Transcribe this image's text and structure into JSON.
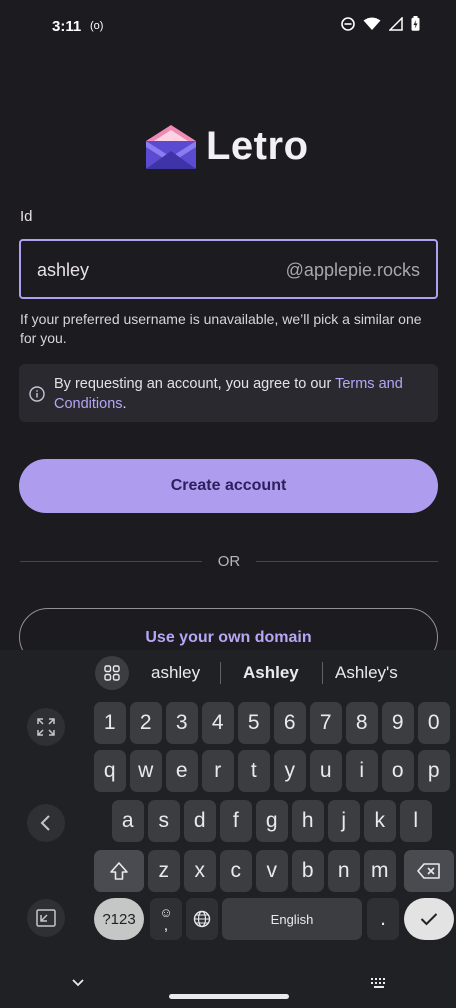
{
  "status": {
    "time": "3:11",
    "cast_label": "(o)"
  },
  "brand": {
    "name": "Letro",
    "color": "#b7a6f5"
  },
  "form": {
    "id_label": "Id",
    "id_value": "ashley",
    "id_domain": "@applepie.rocks",
    "help_text": "If your preferred username is unavailable, we’ll pick a similar one for you."
  },
  "terms": {
    "text_before": "By requesting an account, you agree to our ",
    "link_text": "Terms and Conditions",
    "text_after": "."
  },
  "actions": {
    "create_account": "Create account",
    "or": "OR",
    "use_own_domain": "Use your own domain"
  },
  "keyboard": {
    "suggestions": [
      "ashley",
      "Ashley",
      "Ashley's"
    ],
    "row_numbers": [
      "1",
      "2",
      "3",
      "4",
      "5",
      "6",
      "7",
      "8",
      "9",
      "0"
    ],
    "row_q": [
      "q",
      "w",
      "e",
      "r",
      "t",
      "y",
      "u",
      "i",
      "o",
      "p"
    ],
    "row_a": [
      "a",
      "s",
      "d",
      "f",
      "g",
      "h",
      "j",
      "k",
      "l"
    ],
    "row_z": [
      "z",
      "x",
      "c",
      "v",
      "b",
      "n",
      "m"
    ],
    "symbols_label": "?123",
    "emoji_comma": ",",
    "space_label": "English",
    "period": "."
  }
}
